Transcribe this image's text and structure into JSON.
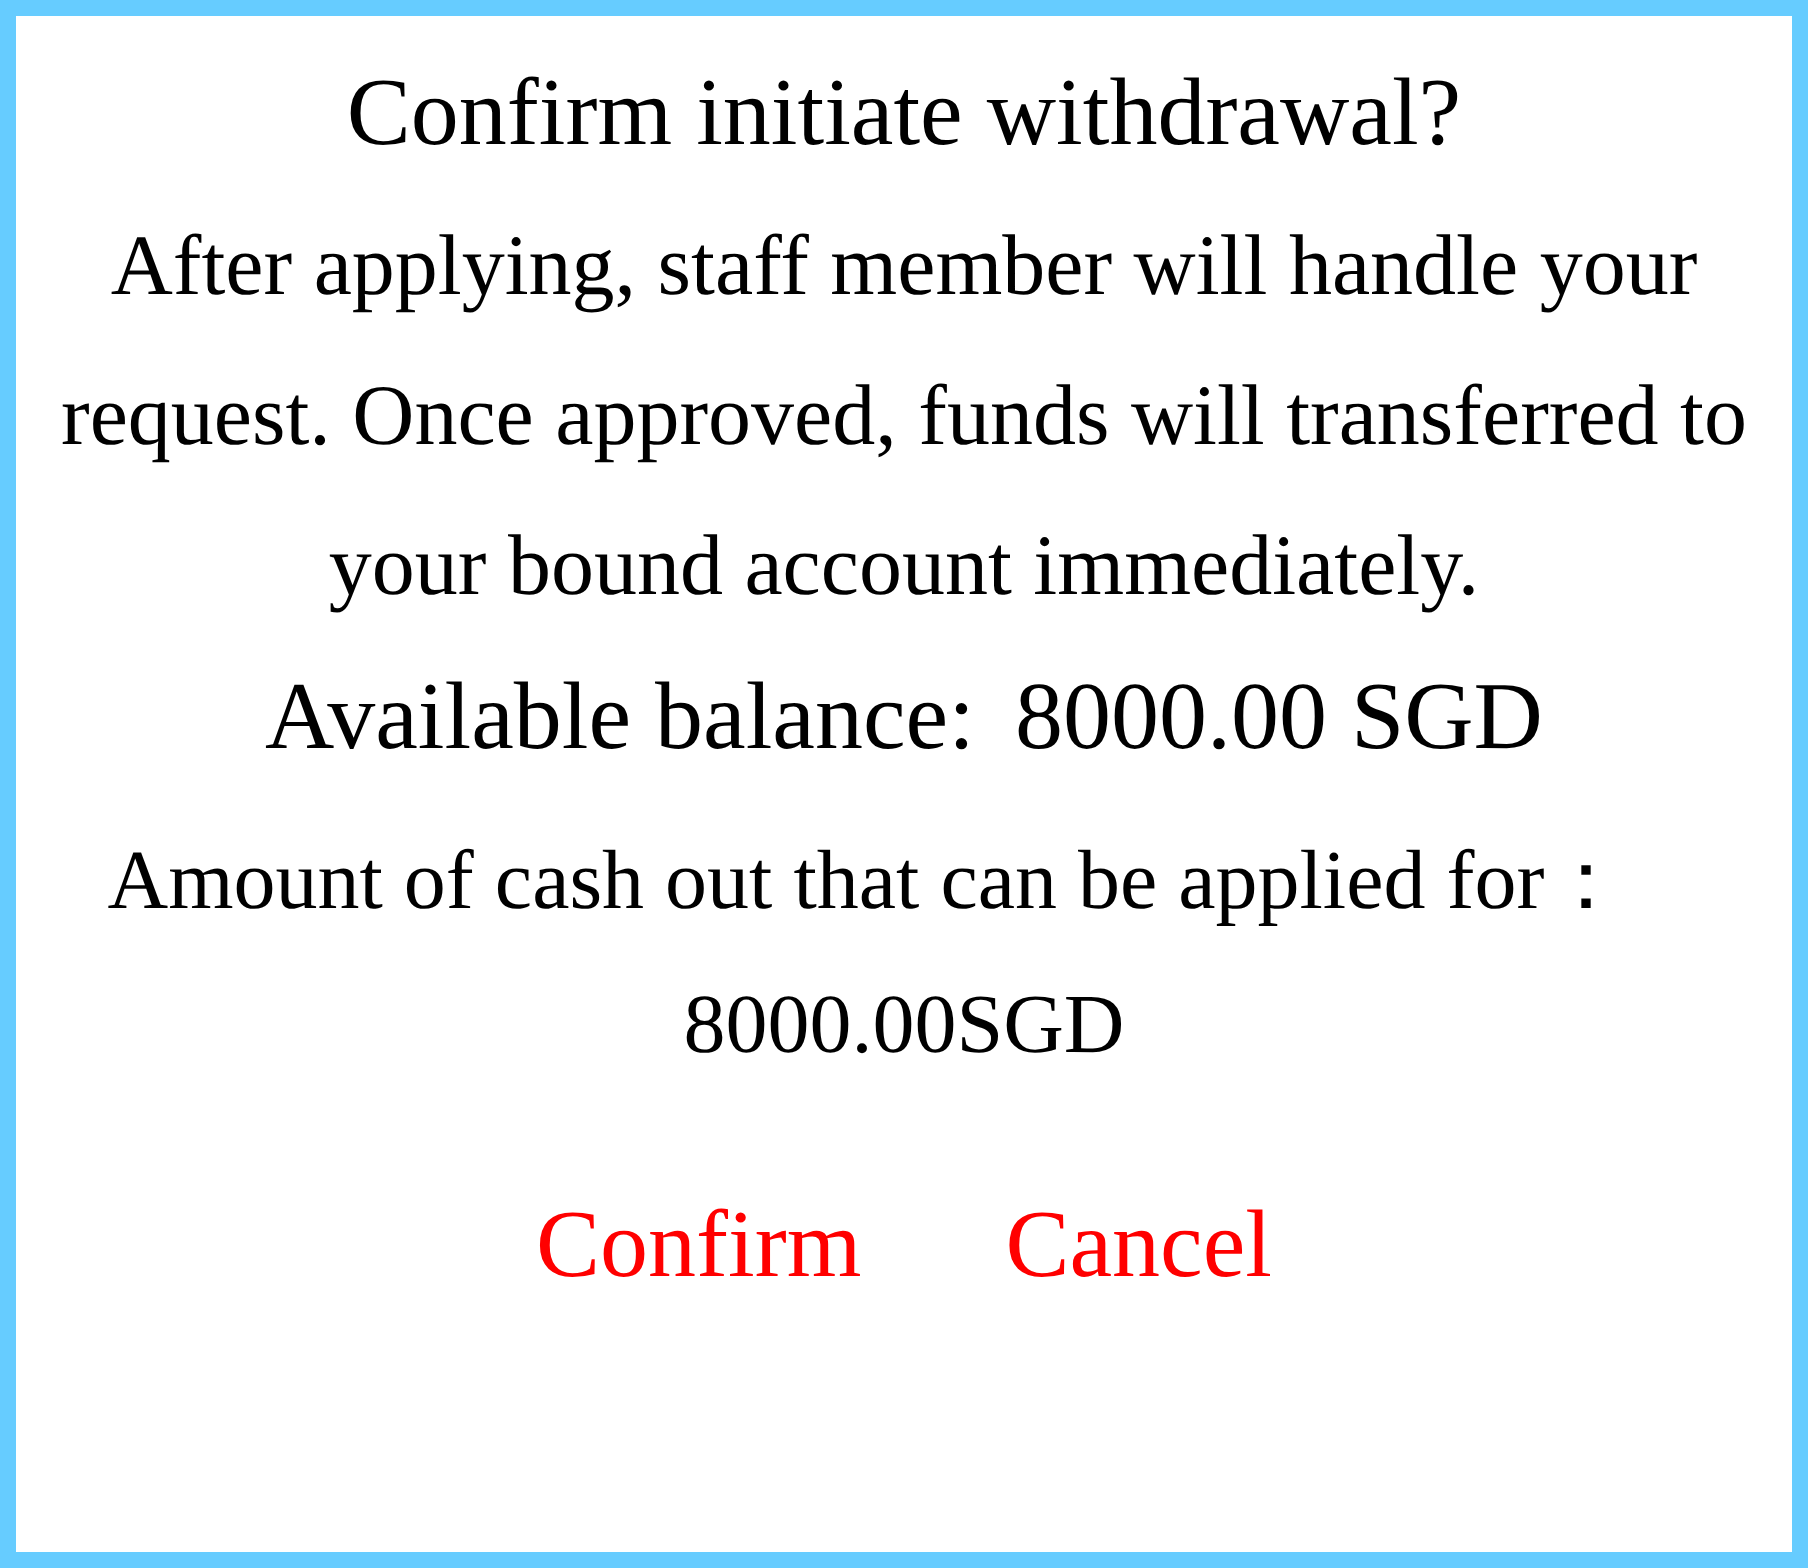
{
  "dialog": {
    "title": "Confirm initiate withdrawal?",
    "message": "After applying, staff member will handle your request. Once approved, funds will transferred to your bound account immediately.",
    "balance": {
      "label": "Available balance:",
      "value": "8000.00 SGD"
    },
    "cash_out": {
      "label": "Amount of cash out that can be applied for：",
      "value": "8000.00SGD"
    },
    "buttons": [
      "Confirm",
      "Cancel"
    ]
  }
}
